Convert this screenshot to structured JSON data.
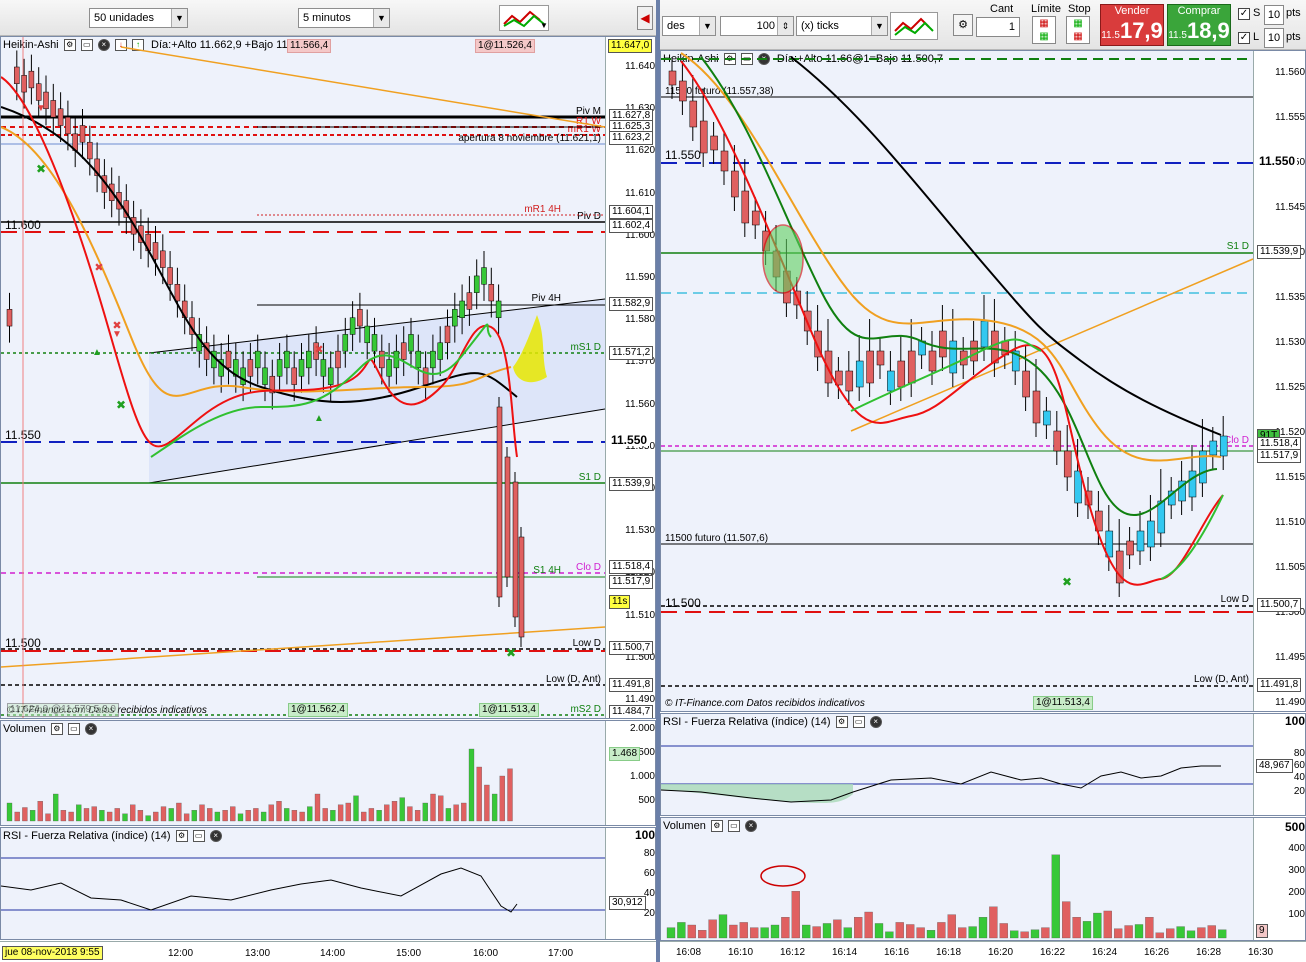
{
  "left": {
    "units_select": "50 unidades",
    "timeframe_select": "5 minutos",
    "main_title": "Heikin-Ashi",
    "main_info": "Día:+Alto 11.662,9 +Bajo 11.5@7",
    "top_tags": [
      "11.566,4",
      "1@11.526,4"
    ],
    "last_price": "11.647,0",
    "yaxis": [
      "11.640",
      "11.630",
      "11.620",
      "11.610",
      "11.600",
      "11.590",
      "11.580",
      "11.570",
      "11.560",
      "11.550",
      "11.540",
      "11.530",
      "11.520",
      "11.510",
      "11.500",
      "11.490"
    ],
    "price_tags": {
      "piv_m": "11.627,8",
      "r1_w": "11.625,3",
      "mr1_w": "11.623,2",
      "mr1_4h": "11.604,1",
      "piv_d": "11.602,4",
      "piv_4h": "11.582,9",
      "ms1_d": "11.571,2",
      "s1_d": "11.539,9",
      "clo_d": "11.518,4",
      "s1_4h": "11.517,9",
      "timer": "11s",
      "low_d": "11.500,7",
      "low_d_ant": "11.491,8",
      "ms2_d": "11.484,7",
      "big_550": "11.550"
    },
    "level_labels": {
      "piv_m": "Piv M",
      "r1_w": "R1 W",
      "mr1_w": "mR1 W",
      "apertura": "apertura 8 noviembre (11.621,1)",
      "mr1_4h": "mR1 4H",
      "piv_d": "Piv D",
      "piv_4h": "Piv 4H",
      "ms1_d": "mS1 D",
      "s1_d": "S1 D",
      "clo_d": "Clo D",
      "s1_4h": "S1 4H",
      "low_d": "Low D",
      "low_d_ant": "Low (D, Ant)",
      "ms2_d": "mS2 D",
      "round_600": "11.600",
      "round_550": "11.550",
      "round_500": "11.500"
    },
    "bottom_tags": [
      "1@11.562,4",
      "1@11.513,4"
    ],
    "bottom_left_text": "11.624,0 @11.579,5 3,0",
    "disclaimer": "© IT-Finance.com Datos recibidos indicativos",
    "volume_title": "Volumen",
    "volume_axis": [
      "2.000",
      "1.500",
      "1.000",
      "500"
    ],
    "volume_tag": "1.468",
    "rsi_title": "RSI - Fuerza Relativa (índice) (14)",
    "rsi_axis": [
      "100",
      "80",
      "60",
      "40",
      "20"
    ],
    "rsi_tag": "30,912",
    "date_label": "jue 08-nov-2018 9:55",
    "xaxis": [
      "12:00",
      "13:00",
      "14:00",
      "15:00",
      "16:00",
      "17:00"
    ]
  },
  "right": {
    "units_select": "des",
    "qty_value": "100",
    "ticks_select": "(x) ticks",
    "cant_label": "Cant",
    "cant_value": "1",
    "limite_label": "Límite",
    "stop_label": "Stop",
    "vender_label": "Vender",
    "vender_small": "11.5",
    "vender_big": "17,9",
    "comprar_label": "Comprar",
    "comprar_small": "11.5",
    "comprar_big": "18,9",
    "s_label": "S",
    "s_value": "10",
    "l_label": "L",
    "l_value": "10",
    "pts": "pts",
    "main_title": "Heikin-Ashi",
    "main_info": "Día:+Alto 11.66@1=Bajo 11.500,7",
    "yaxis": [
      "11.560",
      "11.555",
      "11.550",
      "11.545",
      "11.540",
      "11.535",
      "11.530",
      "11.525",
      "11.520",
      "11.515",
      "11.510",
      "11.505",
      "11.500",
      "11.495",
      "11.490"
    ],
    "price_tags": {
      "s1_d": "11.539,9",
      "clo_d": "11.518,4",
      "last": "11.517,9",
      "low_d": "11.500,7",
      "low_d_ant": "11.491,8",
      "timer": "91T",
      "big_550": "11.550"
    },
    "level_labels": {
      "future_550": "11550 futuro (11.557,38)",
      "round_550": "11.550",
      "s1_d": "S1 D",
      "future_500": "11500 futuro (11.507,6)",
      "round_500": "11.500",
      "low_d": "Low D",
      "low_d_ant": "Low (D, Ant)",
      "clo_d": "Clo D"
    },
    "bottom_tag": "1@11.513,4",
    "disclaimer": "© IT-Finance.com  Datos recibidos indicativos",
    "rsi_title": "RSI - Fuerza Relativa (índice) (14)",
    "rsi_axis": [
      "100",
      "80",
      "60",
      "40",
      "20"
    ],
    "rsi_tag": "48,967",
    "volume_title": "Volumen",
    "volume_axis": [
      "500",
      "400",
      "300",
      "200",
      "100"
    ],
    "volume_tag": "9",
    "xaxis": [
      "16:08",
      "16:10",
      "16:12",
      "16:14",
      "16:16",
      "16:18",
      "16:20",
      "16:22",
      "16:24",
      "16:26",
      "16:28",
      "16:30"
    ]
  },
  "colors": {
    "bull": "#37c837",
    "bear": "#e06060",
    "bull_right": "#33c8f0",
    "pivot_black": "#000000",
    "red_dash": "#e01010",
    "blue_dash": "#1020c0",
    "green_line": "#108010",
    "magenta_dash": "#d020d0",
    "orange": "#f0a020",
    "ma_black": "#000000",
    "ma_red": "#ee1111",
    "ma_green": "#30c030"
  }
}
